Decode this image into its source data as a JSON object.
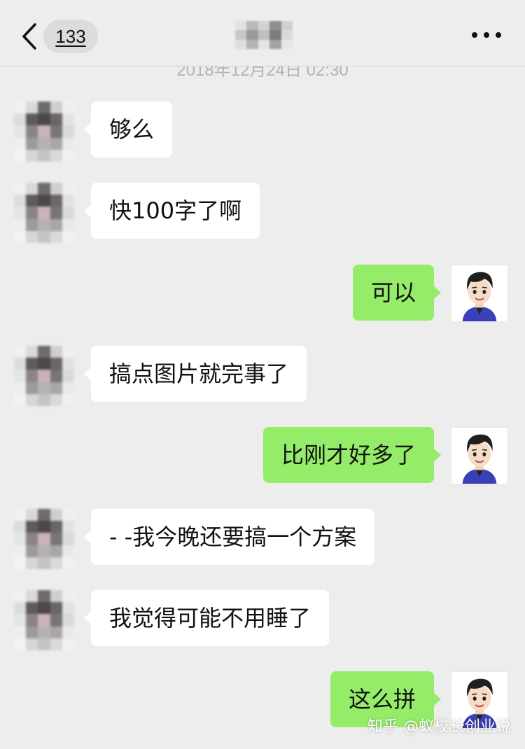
{
  "header": {
    "unread_count": "133",
    "contact_name": ""
  },
  "timestamp": "2018年12月24日 02:30",
  "messages": [
    {
      "side": "in",
      "text": "够么"
    },
    {
      "side": "in",
      "text": "快100字了啊"
    },
    {
      "side": "out",
      "text": "可以"
    },
    {
      "side": "in",
      "text": "搞点图片就完事了"
    },
    {
      "side": "out",
      "text": "比刚才好多了"
    },
    {
      "side": "in",
      "text": "- -我今晚还要搞一个方案"
    },
    {
      "side": "in",
      "text": "我觉得可能不用睡了"
    },
    {
      "side": "out",
      "text": "这么拼"
    }
  ],
  "watermark": "知乎 @蚁校长创业说",
  "colors": {
    "background": "#ededed",
    "bubble_out": "#95ec69",
    "bubble_in": "#ffffff"
  },
  "icons": {
    "back": "chevron-left-icon",
    "more": "ellipsis-icon"
  }
}
